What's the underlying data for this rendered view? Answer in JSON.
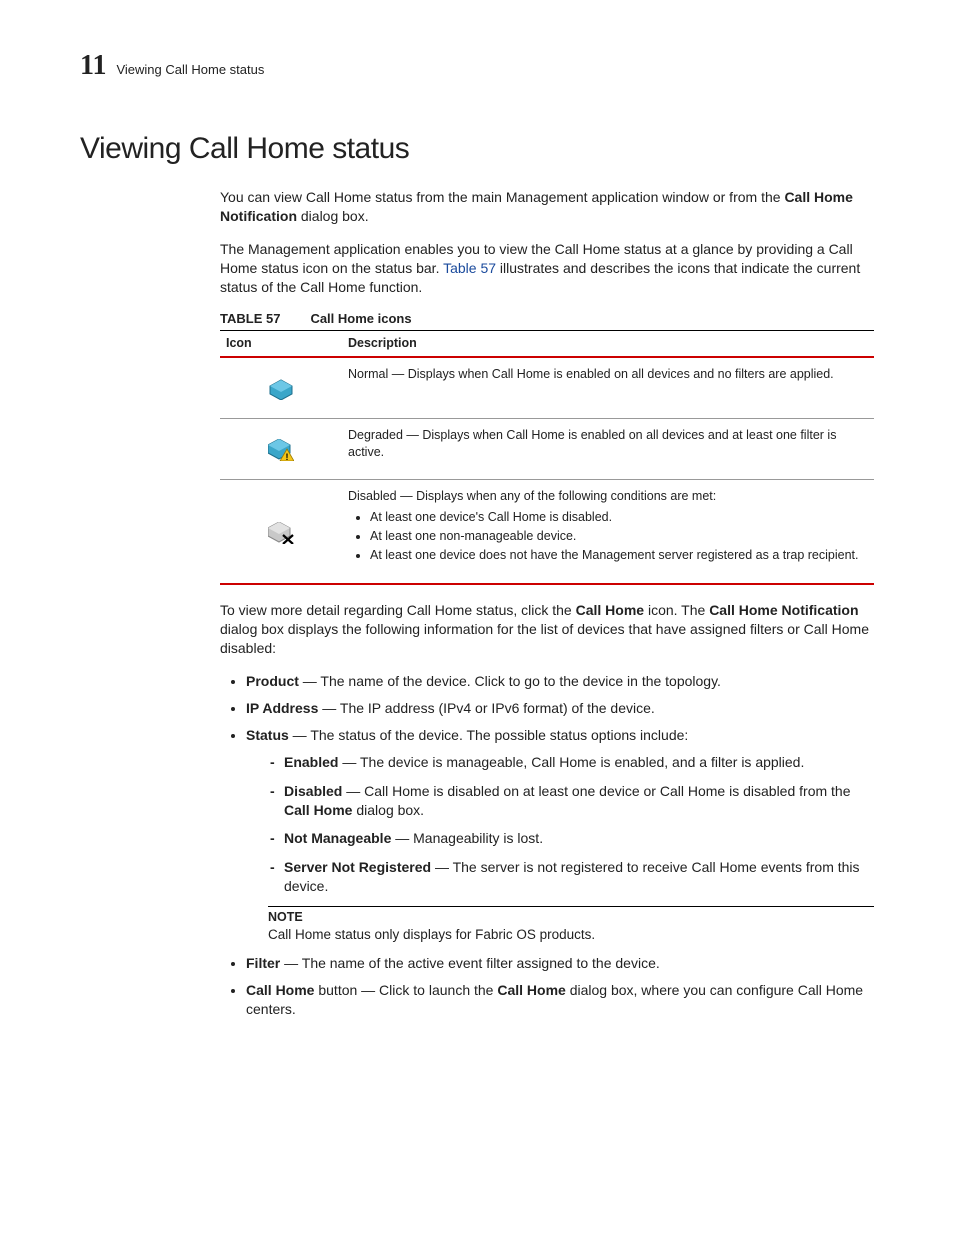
{
  "header": {
    "chapter": "11",
    "title": "Viewing Call Home status"
  },
  "h1": "Viewing Call Home status",
  "intro": {
    "p1_pre": "You can view Call Home status from the main Management application window or from the ",
    "p1_bold": "Call Home Notification",
    "p1_post": " dialog box.",
    "p2_pre": "The Management application enables you to view the Call Home status at a glance by providing a Call Home status icon on the status bar. ",
    "p2_link": "Table 57",
    "p2_post": " illustrates and describes the icons that indicate the current status of the Call Home function."
  },
  "table": {
    "caption_label": "TABLE 57",
    "caption_text": "Call Home icons",
    "col1": "Icon",
    "col2": "Description",
    "rows": [
      {
        "desc": "Normal —  Displays when Call Home is enabled on all devices and no filters are applied."
      },
      {
        "desc": "Degraded —  Displays when Call Home is enabled on all devices and at least one filter is active."
      },
      {
        "desc_lead": "Disabled —  Displays when any of the following conditions are met:",
        "bullets": [
          "At least one device's Call Home is disabled.",
          "At least one non-manageable device.",
          "At least one device does not have the Management server registered as a trap recipient."
        ]
      }
    ]
  },
  "after_table": {
    "pre": "To view more detail regarding Call Home status, click the ",
    "bold1": "Call Home",
    "mid1": " icon. The ",
    "bold2": "Call Home Notification",
    "post": " dialog box displays the following information for the list of devices that have assigned filters or Call Home disabled:"
  },
  "list": {
    "product_b": "Product",
    "product_t": " — The name of the device. Click to go to the device in the topology.",
    "ip_b": "IP Address",
    "ip_t": " — The IP address (IPv4 or IPv6 format) of the device.",
    "status_b": "Status",
    "status_t": " — The status of the device. The possible status options include:",
    "enabled_b": "Enabled",
    "enabled_t": " — The device is manageable, Call Home is enabled, and a filter is applied.",
    "disabled_b": "Disabled",
    "disabled_t_pre": " — Call Home is disabled on at least one device or Call Home is disabled from the ",
    "disabled_t_bold": "Call Home",
    "disabled_t_post": " dialog box.",
    "notman_b": "Not Manageable",
    "notman_t": " — Manageability is lost.",
    "srv_b": "Server Not Registered",
    "srv_t": " — The server is not registered to receive Call Home events from this device.",
    "filter_b": "Filter",
    "filter_t": " — The name of the active event filter assigned to the device.",
    "ch_b": "Call Home",
    "ch_t_pre": " button — Click to launch the ",
    "ch_t_bold": "Call Home",
    "ch_t_post": " dialog box, where you can configure Call Home centers."
  },
  "note": {
    "label": "NOTE",
    "text": "Call Home status only displays for Fabric OS products."
  }
}
